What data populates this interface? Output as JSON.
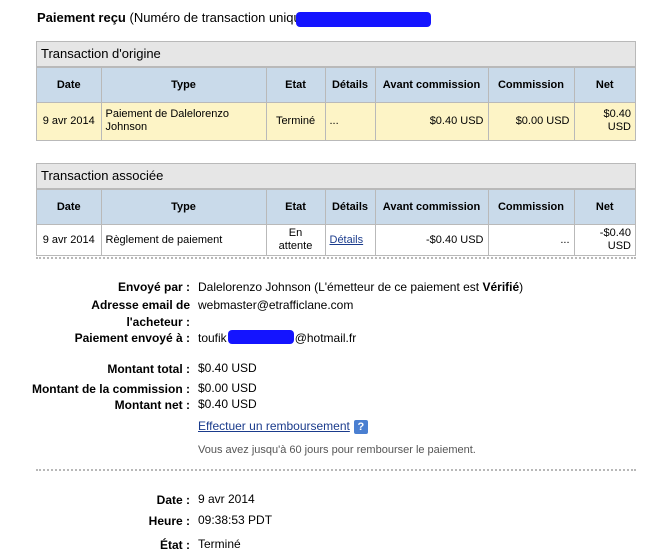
{
  "header": {
    "title_bold": "Paiement reçu",
    "title_rest": " (Numéro de transaction unique "
  },
  "table_columns": [
    "Date",
    "Type",
    "Etat",
    "Détails",
    "Avant commission",
    "Commission",
    "Net"
  ],
  "origin": {
    "title": "Transaction d'origine",
    "row": {
      "date": "9 avr 2014",
      "type": "Paiement de Dalelorenzo Johnson",
      "etat": "Terminé",
      "details": "...",
      "avant": "$0.40 USD",
      "commission": "$0.00 USD",
      "net": "$0.40 USD"
    }
  },
  "related": {
    "title": "Transaction associée",
    "row": {
      "date": "9 avr 2014",
      "type": "Règlement de paiement",
      "etat": "En attente",
      "details": "Détails",
      "avant": "-$0.40 USD",
      "commission": "...",
      "net": "-$0.40 USD"
    }
  },
  "info": {
    "sender_label": "Envoyé par :",
    "sender_value_pre": "Dalelorenzo Johnson (L'émetteur de ce paiement est ",
    "sender_value_status": "Vérifié",
    "sender_value_post": ")",
    "email_label": "Adresse email de l'acheteur :",
    "email_value": "webmaster@etrafficlane.com",
    "sent_to_label": "Paiement envoyé à :",
    "sent_to_prefix": "toufik",
    "sent_to_suffix": "@hotmail.fr"
  },
  "amounts": {
    "total_label": "Montant total :",
    "total_value": "$0.40 USD",
    "commission_label": "Montant de la commission :",
    "commission_value": "$0.00 USD",
    "net_label": "Montant net :",
    "net_value": "$0.40 USD",
    "refund_link": "Effectuer un remboursement",
    "refund_note": "Vous avez jusqu'à 60 jours pour rembourser le paiement."
  },
  "details": {
    "date_label": "Date :",
    "date_value": "9 avr 2014",
    "time_label": "Heure :",
    "time_value": "09:38:53 PDT",
    "status_label": "État :",
    "status_value": "Terminé"
  },
  "colors": {
    "header_bg": "#c9daea",
    "highlight_row": "#fdf4c6",
    "redaction": "#1414ff",
    "link": "#1a3b8c"
  }
}
